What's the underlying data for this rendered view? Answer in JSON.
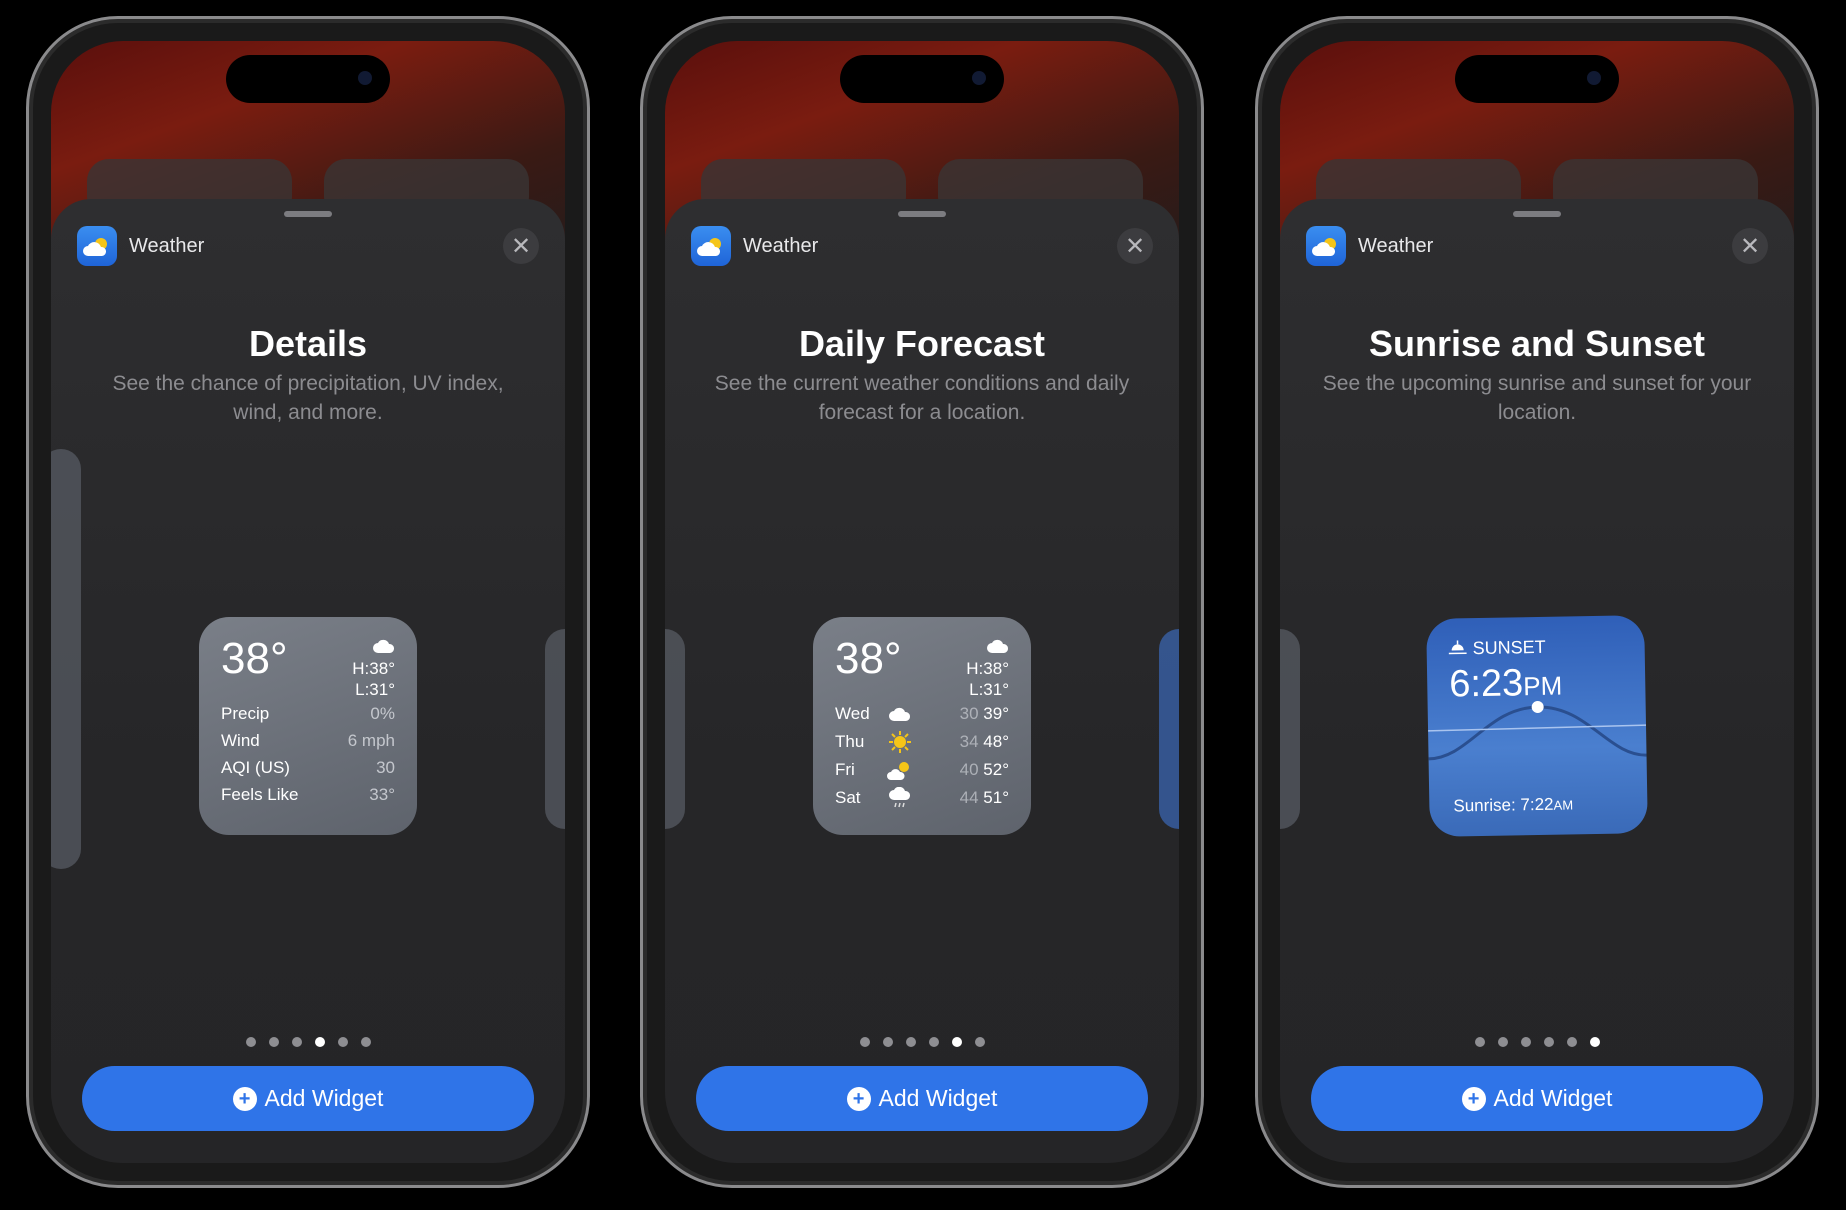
{
  "app": {
    "name": "Weather",
    "close_icon": "close-icon",
    "add_label": "Add Widget",
    "accent": "#2f74e8"
  },
  "phones": [
    {
      "title": "Details",
      "desc": "See the chance of precipitation, UV index, wind, and more.",
      "page_index": 4,
      "page_count": 6,
      "widget": {
        "temp": "38°",
        "high": "H:38°",
        "low": "L:31°",
        "rows": [
          {
            "label": "Precip",
            "value": "0%"
          },
          {
            "label": "Wind",
            "value": "6 mph"
          },
          {
            "label": "AQI (US)",
            "value": "30"
          },
          {
            "label": "Feels Like",
            "value": "33°"
          }
        ]
      }
    },
    {
      "title": "Daily Forecast",
      "desc": "See the current weather conditions and daily forecast for a location.",
      "page_index": 5,
      "page_count": 6,
      "widget": {
        "temp": "38°",
        "high": "H:38°",
        "low": "L:31°",
        "days": [
          {
            "day": "Wed",
            "icon": "cloud-icon",
            "lo": "30",
            "hi": "39°"
          },
          {
            "day": "Thu",
            "icon": "sun-icon",
            "lo": "34",
            "hi": "48°"
          },
          {
            "day": "Fri",
            "icon": "partly-cloudy-icon",
            "lo": "40",
            "hi": "52°"
          },
          {
            "day": "Sat",
            "icon": "rain-icon",
            "lo": "44",
            "hi": "51°"
          }
        ]
      }
    },
    {
      "title": "Sunrise and Sunset",
      "desc": "See the upcoming sunrise and sunset for your location.",
      "page_index": 6,
      "page_count": 6,
      "widget": {
        "label": "SUNSET",
        "time": "6:23",
        "ampm": "PM",
        "sunrise_label": "Sunrise: 7:22",
        "sunrise_ampm": "AM"
      }
    }
  ]
}
